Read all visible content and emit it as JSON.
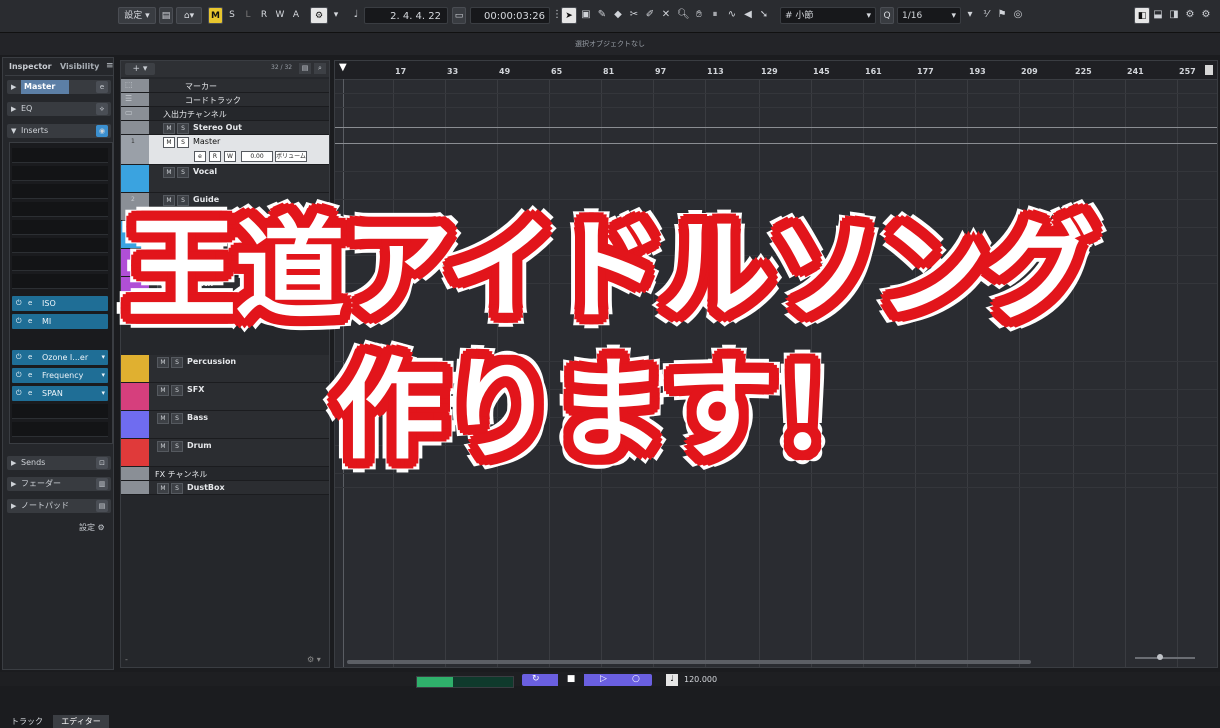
{
  "toolbar": {
    "settings_label": "設定",
    "mode_buttons": [
      "M",
      "S",
      "L",
      "R",
      "W",
      "A"
    ],
    "position_bars": "2. 4. 4. 22",
    "position_time": "00:00:03:26",
    "grid_type": "小節",
    "quantize_label": "Q",
    "quantize_value": "1/16"
  },
  "info_line": "選択オブジェクトなし",
  "inspector": {
    "tab_inspector": "Inspector",
    "tab_visibility": "Visibility",
    "channel": "Master",
    "eq": "EQ",
    "inserts": "Inserts",
    "plugins": [
      "ISO",
      "MI",
      "Ozone I...er",
      "Frequency",
      "SPAN"
    ],
    "sends": "Sends",
    "fader": "フェーダー",
    "notepad": "ノートパッド",
    "settings": "設定",
    "bottom_tab_track": "トラック",
    "bottom_tab_editor": "エディター"
  },
  "tracklist": {
    "count": "32 / 32",
    "tracks": [
      {
        "name": "マーカー"
      },
      {
        "name": "コードトラック"
      },
      {
        "name": "入出力チャンネル"
      },
      {
        "name": "Stereo Out"
      },
      {
        "name": "Master",
        "number": "1",
        "volume": "0.00",
        "volume_label": "ボリューム"
      },
      {
        "name": "Vocal"
      },
      {
        "name": "Guide",
        "number": "2"
      },
      {
        "name": "Ki"
      },
      {
        "name": "Synth"
      },
      {
        "name": "Percussion"
      },
      {
        "name": "SFX"
      },
      {
        "name": "Bass"
      },
      {
        "name": "Drum"
      },
      {
        "name": "FX チャンネル"
      },
      {
        "name": "DustBox"
      }
    ]
  },
  "ruler": [
    "17",
    "33",
    "49",
    "65",
    "81",
    "97",
    "113",
    "129",
    "145",
    "161",
    "177",
    "193",
    "209",
    "225",
    "241",
    "257"
  ],
  "transport": {
    "tempo": "120.000"
  },
  "overlay": {
    "line1": "王道アイドルソング",
    "line2": "作ります！"
  },
  "colors": {
    "overlay_red": "#e2151b",
    "vocal": "#3aa3e0",
    "synth": "#b04fd6",
    "percussion": "#e0b030",
    "sfx": "#d63f7d",
    "bass": "#6f6cf0",
    "drum": "#e03a3a"
  }
}
